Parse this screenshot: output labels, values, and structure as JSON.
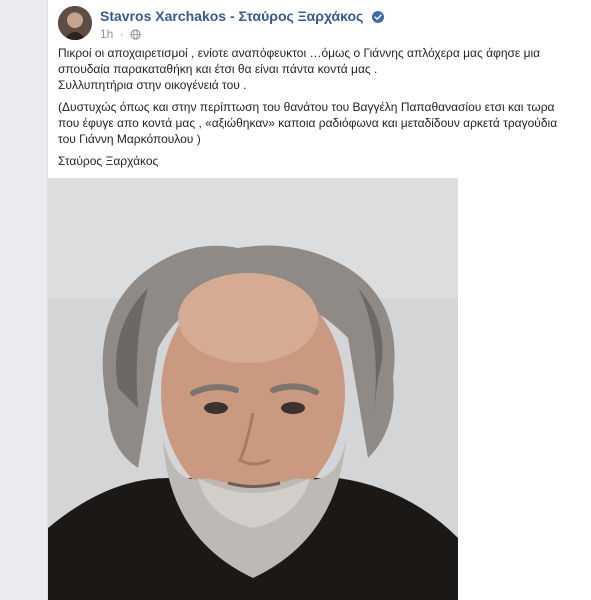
{
  "post": {
    "author": "Stavros Xarchakos - Σταύρος Ξαρχάκος",
    "time": "1h",
    "dot": "·",
    "paragraphs": [
      "Πικροί οι αποχαιρετισμοί , ενίοτε αναπόφευκτοι …όμως ο Γιάννης απλόχερα μας άφησε μια σπουδαία παρακαταθήκη και έτσι θα είναι πάντα κοντά μας .",
      "Συλλυπητήρια στην οικογένειά του .",
      "(Δυστυχώς όπως και στην περίπτωση του θανάτου του Βαγγέλη Παπαθανασίου ετσι και τωρα που έφυγε απο κοντά μας , «αξιώθηκαν» καποια ραδιόφωνα και μεταδίδουν αρκετά τραγούδια του Γιάννη Μαρκόπουλου )",
      "Σταύρος Ξαρχάκος"
    ]
  },
  "colors": {
    "link": "#385898",
    "verified": "#4267b2",
    "meta": "#90949c",
    "text": "#1d2129"
  },
  "icons": {
    "verified": "verified-badge-icon",
    "audience": "globe-icon"
  }
}
